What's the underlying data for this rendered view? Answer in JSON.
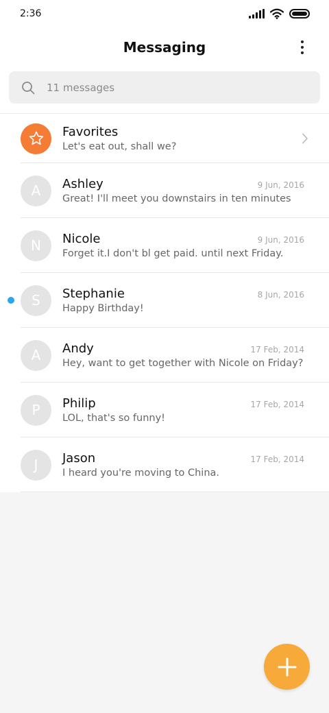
{
  "status_bar": {
    "time": "2:36",
    "icons": [
      "signal-icon",
      "wifi-icon",
      "battery-icon"
    ]
  },
  "header": {
    "title": "Messaging",
    "menu_icon": "more-vertical-icon"
  },
  "search": {
    "placeholder": "11 messages",
    "icon": "search-icon"
  },
  "favorites": {
    "name": "Favorites",
    "preview": "Let's eat out, shall we?",
    "icon": "star-icon",
    "accent": "#f57c35"
  },
  "conversations": [
    {
      "initial": "A",
      "name": "Ashley",
      "date": "9 Jun, 2016",
      "preview": "Great! I'll meet you downstairs in ten minutes",
      "unread": false
    },
    {
      "initial": "N",
      "name": "Nicole",
      "date": "9 Jun, 2016",
      "preview": "Forget it.I don't bl get paid. until next Friday.",
      "unread": false
    },
    {
      "initial": "S",
      "name": "Stephanie",
      "date": "8 Jun, 2016",
      "preview": "Happy Birthday!",
      "unread": true
    },
    {
      "initial": "A",
      "name": "Andy",
      "date": "17 Feb, 2014",
      "preview": "Hey, want to get together with Nicole on Friday?",
      "unread": false
    },
    {
      "initial": "P",
      "name": "Philip",
      "date": "17 Feb, 2014",
      "preview": "LOL, that's so funny!",
      "unread": false
    },
    {
      "initial": "J",
      "name": "Jason",
      "date": "17 Feb, 2014",
      "preview": "I heard you're moving to China.",
      "unread": false
    }
  ],
  "fab": {
    "icon": "plus-icon",
    "color": "#f7a93a"
  },
  "colors": {
    "unread_dot": "#2aa6ef",
    "avatar_bg": "#e4e4e4"
  }
}
